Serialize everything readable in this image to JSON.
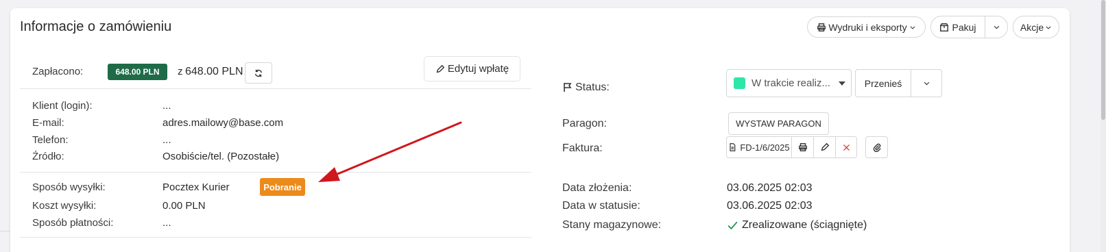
{
  "header": {
    "title": "Informacje o zamówieniu",
    "prints_label": "Wydruki i eksporty",
    "pack_label": "Pakuj",
    "actions_label": "Akcje"
  },
  "payment": {
    "label": "Zapłacono:",
    "paid_amount": "648.00 PLN",
    "of_prefix": "z",
    "total_amount": "648.00 PLN",
    "edit_label": "Edytuj wpłatę"
  },
  "customer": {
    "rows": [
      {
        "label": "Klient (login):",
        "value": "..."
      },
      {
        "label": "E-mail:",
        "value": "adres.mailowy@base.com"
      },
      {
        "label": "Telefon:",
        "value": "..."
      },
      {
        "label": "Źródło:",
        "value": "Osobiście/tel. (Pozostałe)"
      }
    ]
  },
  "shipping": {
    "method_label": "Sposób wysyłki:",
    "method_value": "Pocztex Kurier",
    "cod_badge": "Pobranie",
    "cost_label": "Koszt wysyłki:",
    "cost_value": "0.00 PLN",
    "payment_method_label": "Sposób płatności:",
    "payment_method_value": "..."
  },
  "status": {
    "label": "Status:",
    "value": "W trakcie realiz...",
    "color": "#2ee6a8",
    "move_label": "Przenieś"
  },
  "receipt": {
    "label": "Paragon:",
    "issue_label": "WYSTAW PARAGON"
  },
  "invoice": {
    "label": "Faktura:",
    "number": "FD-1/6/2025"
  },
  "dates": {
    "created_label": "Data złożenia:",
    "created_value": "03.06.2025 02:03",
    "status_date_label": "Data w statusie:",
    "status_date_value": "03.06.2025 02:03",
    "stock_label": "Stany magazynowe:",
    "stock_value": "Zrealizowane (ściągnięte)"
  },
  "colors": {
    "paid_badge": "#1f6b48",
    "cod_badge": "#ec8a1a",
    "arrow": "#d0171c",
    "check": "#2e9a5c",
    "remove": "#d93a3a"
  }
}
